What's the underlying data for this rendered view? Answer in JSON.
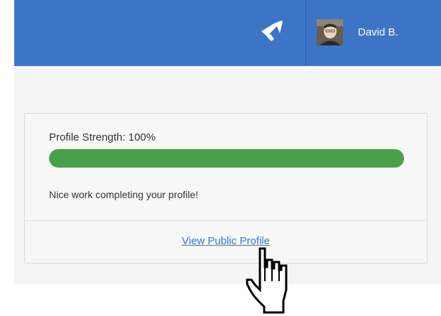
{
  "header": {
    "announcements_icon": "megaphone-icon",
    "user_name": "David B.",
    "avatar": "user-avatar-photo",
    "colors": {
      "bar": "#3d75c6",
      "divider": "#2f62ad",
      "text": "#ffffff"
    }
  },
  "profile_card": {
    "strength_label": "Profile Strength: 100%",
    "strength_progress": 1.0,
    "message": "Nice work completing your profile!",
    "view_link": "View Public Profile",
    "colors": {
      "progress_fill": "#48a049",
      "progress_track": "#e2e2e2",
      "link": "#3d75c6"
    }
  },
  "cursor": {
    "icon": "hand-pointer-icon"
  }
}
